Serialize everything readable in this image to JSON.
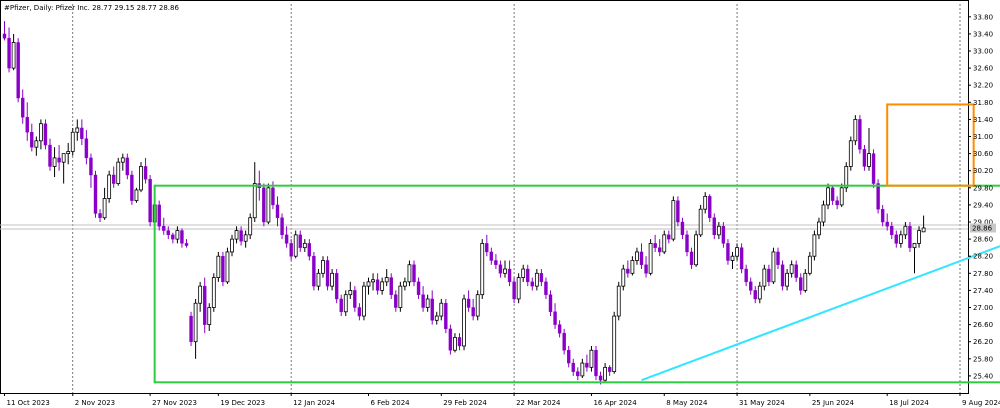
{
  "header": {
    "symbol_info": "#Pfizer, Daily:  Pfizer Inc.  28.77 29.15 28.77 28.86"
  },
  "colors": {
    "bull": "#ffffff",
    "bear": "#8a00c8",
    "outline": "#000000",
    "grid": "#555555",
    "range_box": "#2ecc40",
    "breakout_box": "#ff8c00",
    "trendline": "#33e6ff",
    "price_tag_bg": "#c8c8c8"
  },
  "chart_data": {
    "type": "candlestick",
    "title": "",
    "ylim": [
      25.0,
      34.1
    ],
    "y_ticks": [
      "33.80",
      "33.40",
      "33.00",
      "32.60",
      "32.20",
      "31.80",
      "31.40",
      "31.00",
      "30.60",
      "30.20",
      "29.80",
      "29.40",
      "29.00",
      "28.60",
      "28.20",
      "27.80",
      "27.40",
      "27.00",
      "26.60",
      "26.20",
      "25.80",
      "25.40"
    ],
    "date_labels": [
      "11 Oct 2023",
      "2 Nov 2023",
      "27 Nov 2023",
      "19 Dec 2023",
      "12 Jan 2024",
      "6 Feb 2024",
      "29 Feb 2024",
      "22 Mar 2024",
      "16 Apr 2024",
      "8 May 2024",
      "31 May 2024",
      "25 Jun 2024",
      "18 Jul 2024",
      "9 Aug 2024"
    ],
    "date_label_bar": [
      0,
      15,
      32,
      47,
      63,
      80,
      96,
      112,
      129,
      145,
      161,
      177,
      194,
      210
    ],
    "vline_bars": [
      15,
      63,
      112,
      161,
      210,
      258
    ],
    "last_price": "28.86",
    "ref_price": 28.93,
    "candles": [
      [
        33.4,
        33.7,
        33.25,
        33.3
      ],
      [
        33.3,
        33.55,
        32.5,
        32.6
      ],
      [
        32.6,
        33.4,
        32.55,
        33.2
      ],
      [
        33.2,
        33.3,
        31.8,
        31.9
      ],
      [
        31.9,
        32.1,
        31.3,
        31.45
      ],
      [
        31.45,
        31.8,
        30.9,
        31.1
      ],
      [
        31.1,
        31.3,
        30.65,
        30.75
      ],
      [
        30.75,
        31.0,
        30.55,
        30.9
      ],
      [
        30.9,
        31.4,
        30.7,
        31.3
      ],
      [
        31.3,
        31.4,
        30.7,
        30.8
      ],
      [
        30.8,
        30.95,
        30.2,
        30.3
      ],
      [
        30.3,
        30.75,
        30.05,
        30.5
      ],
      [
        30.5,
        30.8,
        30.2,
        30.4
      ],
      [
        30.4,
        30.6,
        29.9,
        30.6
      ],
      [
        30.6,
        30.85,
        30.35,
        30.65
      ],
      [
        30.65,
        31.2,
        30.55,
        31.1
      ],
      [
        31.1,
        31.4,
        30.9,
        31.2
      ],
      [
        31.2,
        31.4,
        30.8,
        30.95
      ],
      [
        30.95,
        31.15,
        30.35,
        30.5
      ],
      [
        30.5,
        30.6,
        29.8,
        30.1
      ],
      [
        30.1,
        30.2,
        29.1,
        29.2
      ],
      [
        29.2,
        29.3,
        29.0,
        29.1
      ],
      [
        29.1,
        29.8,
        29.05,
        29.55
      ],
      [
        29.55,
        30.2,
        29.45,
        30.1
      ],
      [
        30.1,
        30.3,
        29.8,
        29.9
      ],
      [
        29.9,
        30.5,
        29.85,
        30.4
      ],
      [
        30.4,
        30.6,
        30.2,
        30.5
      ],
      [
        30.5,
        30.6,
        30.0,
        30.1
      ],
      [
        30.1,
        30.2,
        29.4,
        29.5
      ],
      [
        29.5,
        29.8,
        29.45,
        29.75
      ],
      [
        29.75,
        30.4,
        29.7,
        30.3
      ],
      [
        30.3,
        30.5,
        29.9,
        30.0
      ],
      [
        30.0,
        30.1,
        28.9,
        29.0
      ],
      [
        29.0,
        29.5,
        28.8,
        29.4
      ],
      [
        29.4,
        29.5,
        28.8,
        28.9
      ],
      [
        28.9,
        29.1,
        28.7,
        28.8
      ],
      [
        28.8,
        28.9,
        28.6,
        28.7
      ],
      [
        28.7,
        28.75,
        28.5,
        28.6
      ],
      [
        28.6,
        28.9,
        28.5,
        28.8
      ],
      [
        28.8,
        28.85,
        28.4,
        28.5
      ],
      [
        28.5,
        28.6,
        28.4,
        28.45
      ],
      [
        26.8,
        26.9,
        26.1,
        26.2
      ],
      [
        26.2,
        27.2,
        25.8,
        27.1
      ],
      [
        27.1,
        27.6,
        26.9,
        27.5
      ],
      [
        27.5,
        27.7,
        26.4,
        26.6
      ],
      [
        26.6,
        27.1,
        26.45,
        27.0
      ],
      [
        27.0,
        27.8,
        26.9,
        27.7
      ],
      [
        27.7,
        28.3,
        27.6,
        28.2
      ],
      [
        28.2,
        28.3,
        27.5,
        27.6
      ],
      [
        27.6,
        28.4,
        27.55,
        28.3
      ],
      [
        28.3,
        28.7,
        28.2,
        28.6
      ],
      [
        28.6,
        28.9,
        28.5,
        28.8
      ],
      [
        28.8,
        28.9,
        28.45,
        28.55
      ],
      [
        28.55,
        28.8,
        28.4,
        28.7
      ],
      [
        28.7,
        29.2,
        28.6,
        29.1
      ],
      [
        29.1,
        30.4,
        29.0,
        29.9
      ],
      [
        29.9,
        30.2,
        29.5,
        29.8
      ],
      [
        29.8,
        29.9,
        28.9,
        29.0
      ],
      [
        29.0,
        29.9,
        28.95,
        29.8
      ],
      [
        29.8,
        29.95,
        29.3,
        29.4
      ],
      [
        29.4,
        29.6,
        28.9,
        29.1
      ],
      [
        29.1,
        29.2,
        28.6,
        28.7
      ],
      [
        28.7,
        28.9,
        28.4,
        28.5
      ],
      [
        28.5,
        28.6,
        28.1,
        28.2
      ],
      [
        28.2,
        28.8,
        28.15,
        28.7
      ],
      [
        28.7,
        28.8,
        28.3,
        28.4
      ],
      [
        28.4,
        28.6,
        28.3,
        28.5
      ],
      [
        28.5,
        28.6,
        28.1,
        28.2
      ],
      [
        28.2,
        28.3,
        27.4,
        27.5
      ],
      [
        27.5,
        27.9,
        27.4,
        27.8
      ],
      [
        27.8,
        28.2,
        27.7,
        28.1
      ],
      [
        28.1,
        28.2,
        27.4,
        27.5
      ],
      [
        27.5,
        27.9,
        27.4,
        27.8
      ],
      [
        27.8,
        27.9,
        27.1,
        27.2
      ],
      [
        27.2,
        27.3,
        26.8,
        26.9
      ],
      [
        26.9,
        27.4,
        26.8,
        27.3
      ],
      [
        27.3,
        27.6,
        27.2,
        27.4
      ],
      [
        27.4,
        27.5,
        26.9,
        27.0
      ],
      [
        27.0,
        27.1,
        26.7,
        26.8
      ],
      [
        26.8,
        27.6,
        26.7,
        27.5
      ],
      [
        27.5,
        27.7,
        27.3,
        27.6
      ],
      [
        27.6,
        27.8,
        27.4,
        27.65
      ],
      [
        27.65,
        27.8,
        27.3,
        27.4
      ],
      [
        27.4,
        27.7,
        27.3,
        27.6
      ],
      [
        27.6,
        27.9,
        27.5,
        27.7
      ],
      [
        27.7,
        27.8,
        27.2,
        27.3
      ],
      [
        27.3,
        27.4,
        26.9,
        27.0
      ],
      [
        27.0,
        27.6,
        26.9,
        27.5
      ],
      [
        27.5,
        27.7,
        27.4,
        27.6
      ],
      [
        27.6,
        28.1,
        27.5,
        28.0
      ],
      [
        28.0,
        28.1,
        27.5,
        27.6
      ],
      [
        27.6,
        27.7,
        27.2,
        27.3
      ],
      [
        27.3,
        27.5,
        26.9,
        27.0
      ],
      [
        27.0,
        27.3,
        26.9,
        27.2
      ],
      [
        27.2,
        27.4,
        26.6,
        26.7
      ],
      [
        26.7,
        26.9,
        26.6,
        26.8
      ],
      [
        26.8,
        27.2,
        26.7,
        27.1
      ],
      [
        27.1,
        27.2,
        26.4,
        26.5
      ],
      [
        26.5,
        26.6,
        25.9,
        26.0
      ],
      [
        26.0,
        26.4,
        25.95,
        26.3
      ],
      [
        26.3,
        26.4,
        26.0,
        26.1
      ],
      [
        26.1,
        27.3,
        26.0,
        27.2
      ],
      [
        27.2,
        27.4,
        26.9,
        27.0
      ],
      [
        27.0,
        27.2,
        26.7,
        26.8
      ],
      [
        26.8,
        27.4,
        26.7,
        27.3
      ],
      [
        27.3,
        28.6,
        27.2,
        28.5
      ],
      [
        28.5,
        28.7,
        28.2,
        28.3
      ],
      [
        28.3,
        28.4,
        28.0,
        28.1
      ],
      [
        28.1,
        28.25,
        27.9,
        28.0
      ],
      [
        28.0,
        28.1,
        27.7,
        27.8
      ],
      [
        27.8,
        28.1,
        27.7,
        27.9
      ],
      [
        27.9,
        28.1,
        27.5,
        27.6
      ],
      [
        27.6,
        27.7,
        27.1,
        27.2
      ],
      [
        27.2,
        27.8,
        27.1,
        27.7
      ],
      [
        27.7,
        28.0,
        27.6,
        27.9
      ],
      [
        27.9,
        28.0,
        27.5,
        27.6
      ],
      [
        27.6,
        27.7,
        27.4,
        27.5
      ],
      [
        27.5,
        27.9,
        27.4,
        27.8
      ],
      [
        27.8,
        27.9,
        27.5,
        27.6
      ],
      [
        27.6,
        27.7,
        27.2,
        27.3
      ],
      [
        27.3,
        27.4,
        26.8,
        26.9
      ],
      [
        26.9,
        27.1,
        26.5,
        26.6
      ],
      [
        26.6,
        26.7,
        26.3,
        26.4
      ],
      [
        26.4,
        26.5,
        25.9,
        26.0
      ],
      [
        26.0,
        26.1,
        25.6,
        25.7
      ],
      [
        25.7,
        25.8,
        25.4,
        25.5
      ],
      [
        25.5,
        25.6,
        25.3,
        25.4
      ],
      [
        25.4,
        25.8,
        25.35,
        25.7
      ],
      [
        25.7,
        25.9,
        25.5,
        25.6
      ],
      [
        25.6,
        26.1,
        25.5,
        26.0
      ],
      [
        26.0,
        26.1,
        25.3,
        25.4
      ],
      [
        25.4,
        25.5,
        25.2,
        25.3
      ],
      [
        25.3,
        25.7,
        25.25,
        25.6
      ],
      [
        25.6,
        25.65,
        25.4,
        25.5
      ],
      [
        25.5,
        26.9,
        25.45,
        26.8
      ],
      [
        26.8,
        27.6,
        26.7,
        27.5
      ],
      [
        27.5,
        28.0,
        27.4,
        27.9
      ],
      [
        27.9,
        28.1,
        27.7,
        27.8
      ],
      [
        27.8,
        28.2,
        27.75,
        28.1
      ],
      [
        28.1,
        28.4,
        28.0,
        28.3
      ],
      [
        28.3,
        28.5,
        27.9,
        28.0
      ],
      [
        28.0,
        28.2,
        27.7,
        27.8
      ],
      [
        27.8,
        28.6,
        27.75,
        28.5
      ],
      [
        28.5,
        28.7,
        28.3,
        28.4
      ],
      [
        28.4,
        28.6,
        28.2,
        28.3
      ],
      [
        28.3,
        28.8,
        28.25,
        28.7
      ],
      [
        28.7,
        28.8,
        28.5,
        28.6
      ],
      [
        28.6,
        29.6,
        28.55,
        29.5
      ],
      [
        29.5,
        29.6,
        28.9,
        29.0
      ],
      [
        29.0,
        29.1,
        28.6,
        28.7
      ],
      [
        28.7,
        28.8,
        28.2,
        28.3
      ],
      [
        28.3,
        28.4,
        27.9,
        28.0
      ],
      [
        28.0,
        28.8,
        27.95,
        28.7
      ],
      [
        28.7,
        29.4,
        28.65,
        29.3
      ],
      [
        29.3,
        29.7,
        29.2,
        29.6
      ],
      [
        29.6,
        29.65,
        29.0,
        29.1
      ],
      [
        29.1,
        29.2,
        28.6,
        28.7
      ],
      [
        28.7,
        29.0,
        28.6,
        28.9
      ],
      [
        28.9,
        29.0,
        28.4,
        28.5
      ],
      [
        28.5,
        28.6,
        28.0,
        28.1
      ],
      [
        28.1,
        28.3,
        27.9,
        28.2
      ],
      [
        28.2,
        28.5,
        28.1,
        28.4
      ],
      [
        28.4,
        28.5,
        27.8,
        27.9
      ],
      [
        27.9,
        28.0,
        27.5,
        27.6
      ],
      [
        27.6,
        27.7,
        27.3,
        27.4
      ],
      [
        27.4,
        27.5,
        27.1,
        27.2
      ],
      [
        27.2,
        27.6,
        27.1,
        27.5
      ],
      [
        27.5,
        28.0,
        27.4,
        27.9
      ],
      [
        27.9,
        28.0,
        27.5,
        27.6
      ],
      [
        27.6,
        28.4,
        27.55,
        28.3
      ],
      [
        28.3,
        28.4,
        27.9,
        28.0
      ],
      [
        28.0,
        28.1,
        27.4,
        27.5
      ],
      [
        27.5,
        27.9,
        27.4,
        27.8
      ],
      [
        27.8,
        28.1,
        27.7,
        28.0
      ],
      [
        28.0,
        28.1,
        27.6,
        27.7
      ],
      [
        27.7,
        27.8,
        27.3,
        27.4
      ],
      [
        27.4,
        27.9,
        27.35,
        27.8
      ],
      [
        27.8,
        28.3,
        27.75,
        28.2
      ],
      [
        28.2,
        28.8,
        28.1,
        28.7
      ],
      [
        28.7,
        29.1,
        28.6,
        29.0
      ],
      [
        29.0,
        29.5,
        28.9,
        29.4
      ],
      [
        29.4,
        29.9,
        29.3,
        29.8
      ],
      [
        29.8,
        29.85,
        29.4,
        29.5
      ],
      [
        29.5,
        29.6,
        29.3,
        29.4
      ],
      [
        29.4,
        29.9,
        29.35,
        29.8
      ],
      [
        29.8,
        30.4,
        29.7,
        30.3
      ],
      [
        30.3,
        31.0,
        30.2,
        30.9
      ],
      [
        30.9,
        31.5,
        30.8,
        31.4
      ],
      [
        31.4,
        31.5,
        30.6,
        30.7
      ],
      [
        30.7,
        30.8,
        30.2,
        30.3
      ],
      [
        30.3,
        31.2,
        30.2,
        30.6
      ],
      [
        30.6,
        30.7,
        29.8,
        29.9
      ],
      [
        29.9,
        30.0,
        29.2,
        29.3
      ],
      [
        29.3,
        29.4,
        28.9,
        29.0
      ],
      [
        29.0,
        29.2,
        28.8,
        28.9
      ],
      [
        28.9,
        29.0,
        28.6,
        28.7
      ],
      [
        28.7,
        28.8,
        28.4,
        28.5
      ],
      [
        28.5,
        28.8,
        28.4,
        28.7
      ],
      [
        28.7,
        29.0,
        28.6,
        28.9
      ],
      [
        28.9,
        29.0,
        28.3,
        28.4
      ],
      [
        28.4,
        28.5,
        27.8,
        28.5
      ],
      [
        28.5,
        28.9,
        28.4,
        28.8
      ],
      [
        28.77,
        29.15,
        28.77,
        28.86
      ]
    ],
    "range_box": {
      "top": 29.85,
      "bottom": 25.25,
      "bar_start": 33,
      "bar_end": 270
    },
    "breakout_box": {
      "top": 31.75,
      "bottom": 29.85,
      "bar_start": 194,
      "bar_end": 213
    },
    "trendline": {
      "bar_start": 140,
      "y_start": 25.3,
      "bar_end": 238,
      "y_end": 29.2
    }
  }
}
